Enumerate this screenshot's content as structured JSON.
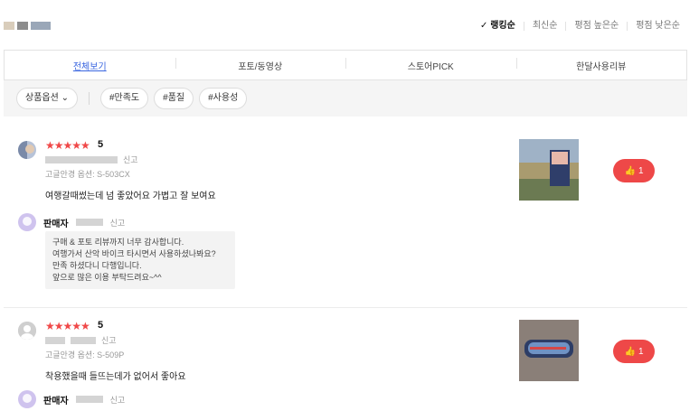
{
  "sort": {
    "options": [
      "랭킹순",
      "최신순",
      "평점 높은순",
      "평점 낮은순"
    ],
    "active_check": "✓"
  },
  "tabs": [
    "전체보기",
    "포토/동영상",
    "스토어PICK",
    "한달사용리뷰"
  ],
  "filters": {
    "option_button": "상품옵션 ⌄",
    "tags": [
      "#만족도",
      "#품질",
      "#사용성"
    ]
  },
  "reviews": [
    {
      "stars": "★★★★★",
      "score": "5",
      "report": "신고",
      "option": "고글안경 옵션: S-503CX",
      "content": "여행갈때썼는데 넘 좋았어요 가볍고 잘 보여요",
      "like_count": "1",
      "seller": {
        "label": "판매자",
        "report": "신고",
        "reply": [
          "구매 & 포토 리뷰까지 너무 감사합니다.",
          "여행가서 산악 바이크 타시면서 사용하셨나봐요?",
          "만족 하셨다니 다행입니다.",
          "앞으로 많은 이용 부탁드려요~^^"
        ]
      }
    },
    {
      "stars": "★★★★★",
      "score": "5",
      "report": "신고",
      "option": "고글안경 옵션: S-509P",
      "content": "착용했을때 들뜨는데가 없어서 좋아요",
      "like_count": "1",
      "seller": {
        "label": "판매자",
        "report": "신고"
      }
    }
  ],
  "colors": {
    "accent_red": "#ee4848",
    "tab_active": "#3a66e0"
  }
}
